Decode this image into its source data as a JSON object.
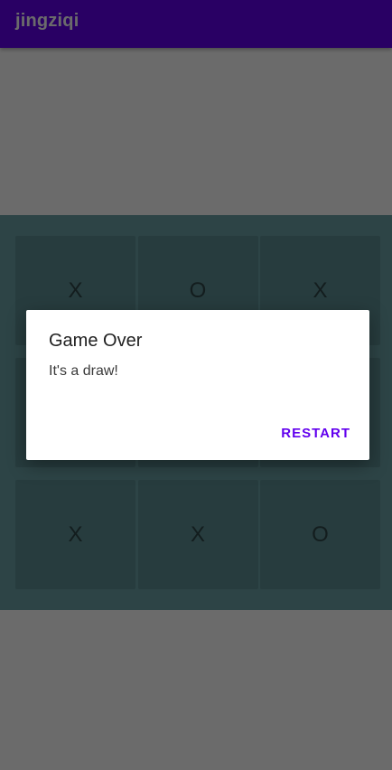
{
  "app_bar": {
    "title": "jingziqi",
    "color": "#6200ee"
  },
  "board": {
    "cells": [
      "X",
      "O",
      "X",
      "",
      "",
      "",
      "X",
      "X",
      "O"
    ],
    "cell_color": "#5e8f93",
    "background_color": "#6ca3a8"
  },
  "dialog": {
    "title": "Game Over",
    "message": "It's a draw!",
    "restart_label": "RESTART",
    "accent_color": "#6200ee"
  }
}
